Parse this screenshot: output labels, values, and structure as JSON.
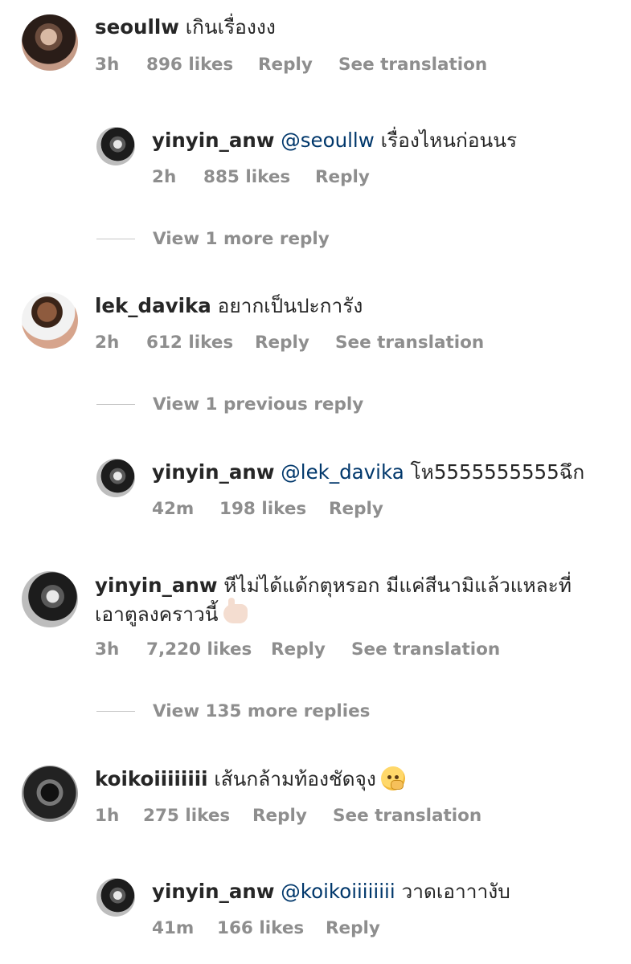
{
  "comments": [
    {
      "username": "seoullw",
      "mention": "",
      "text": " เกินเรื่องงง",
      "time": "3h",
      "likes": "896 likes",
      "reply_label": "Reply",
      "translation_label": "See translation",
      "avatar_icon": "profile-photo-seoullw"
    },
    {
      "username": "yinyin_anw",
      "mention": " @seoullw",
      "text": " เรื่องไหนก่อนนร",
      "time": "2h",
      "likes": "885 likes",
      "reply_label": "Reply",
      "avatar_icon": "profile-photo-yinyin-anw"
    },
    {
      "username": "lek_davika",
      "mention": "",
      "text": " อยากเป็นปะการัง",
      "time": "2h",
      "likes": "612 likes",
      "reply_label": "Reply",
      "translation_label": "See translation",
      "avatar_icon": "profile-photo-lek-davika"
    },
    {
      "username": "yinyin_anw",
      "mention": " @lek_davika",
      "text": " โห5555555555ฉึก",
      "time": "42m",
      "likes": "198 likes",
      "reply_label": "Reply",
      "avatar_icon": "profile-photo-yinyin-anw"
    },
    {
      "username": "yinyin_anw",
      "mention": "",
      "text": " หีไม่ได้แด้กตุหรอก มีแค่สีนามิแล้วแหละที่",
      "text_line_2": "เอาตูลงคราวนี้",
      "emoji": "call-me-hand-emoji",
      "time": "3h",
      "likes": "7,220 likes",
      "reply_label": "Reply",
      "translation_label": "See translation",
      "avatar_icon": "profile-photo-yinyin-anw"
    },
    {
      "username": "koikoiiiiiiii",
      "mention": "",
      "text": " เส้นกล้ามท้องชัดจุง",
      "emoji": "face-with-hand-over-mouth-emoji",
      "time": "1h",
      "likes": "275 likes",
      "reply_label": "Reply",
      "translation_label": "See translation",
      "avatar_icon": "profile-photo-koikoiiiiiiii"
    },
    {
      "username": "yinyin_anw",
      "mention": " @koikoiiiiiiii",
      "text": " วาดเอาาางับ",
      "time": "41m",
      "likes": "166 likes",
      "reply_label": "Reply",
      "avatar_icon": "profile-photo-yinyin-anw"
    }
  ],
  "view_replies": [
    "View 1 more reply",
    "View 1 previous reply",
    "View 135 more replies"
  ],
  "colors": {
    "text": "#262626",
    "meta": "#8e8e8e",
    "mention": "#00376b",
    "line": "#c7c7c7"
  }
}
